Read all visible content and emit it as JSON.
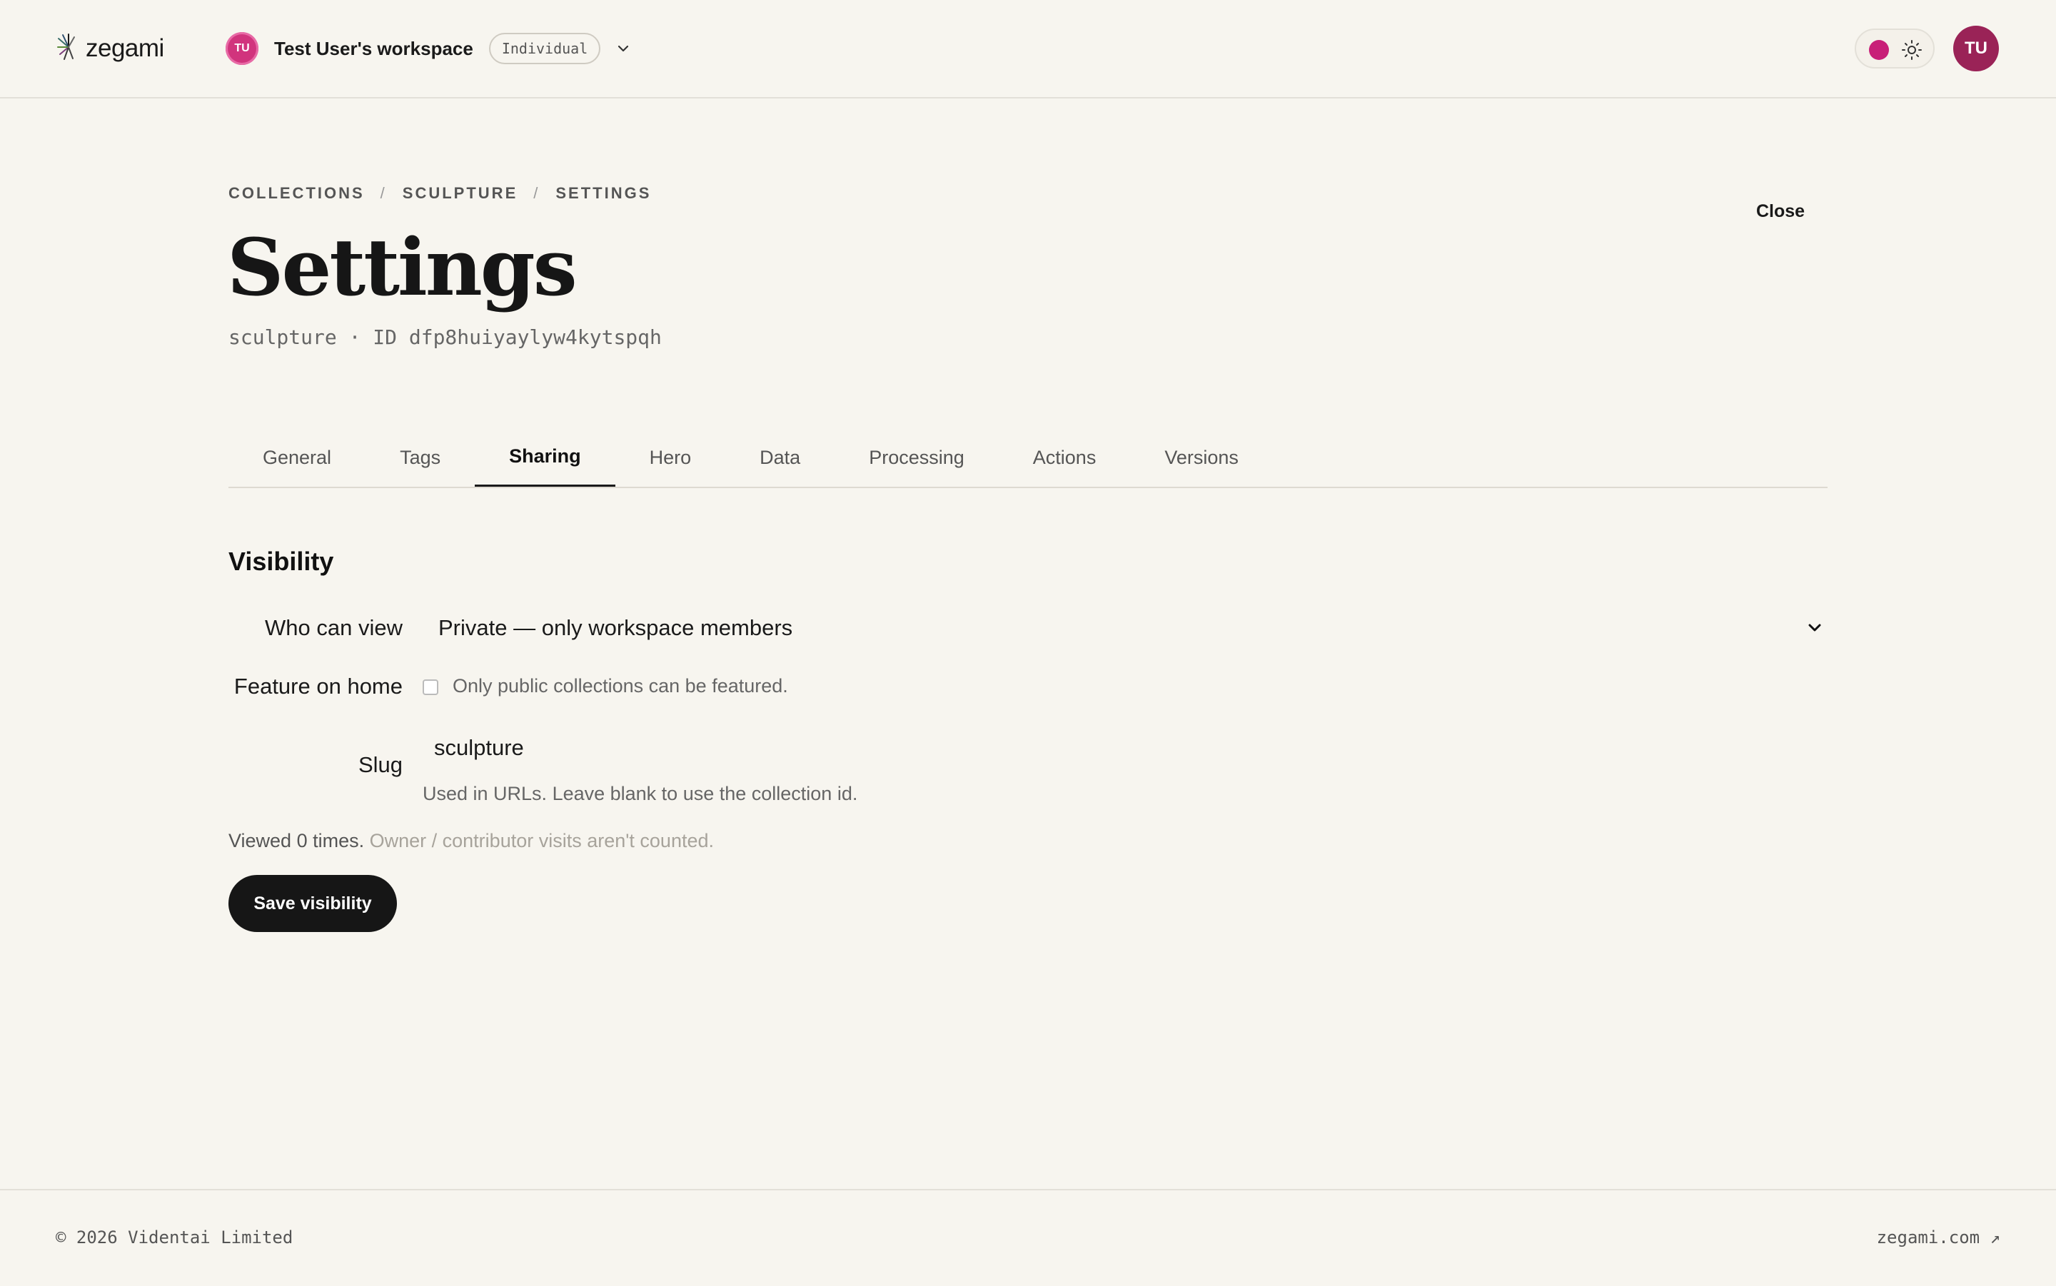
{
  "header": {
    "logo_text": "zegami",
    "workspace": {
      "avatar_initials": "TU",
      "name": "Test User's workspace",
      "plan_badge": "Individual"
    },
    "theme_accent": "#c81f78",
    "user_avatar_initials": "TU"
  },
  "breadcrumb": [
    "COLLECTIONS",
    "SCULPTURE",
    "SETTINGS"
  ],
  "breadcrumb_separator": "/",
  "close_label": "Close",
  "page_title": "Settings",
  "subtitle": "sculpture · ID dfp8huiyaylyw4kytspqh",
  "tabs": [
    {
      "label": "General"
    },
    {
      "label": "Tags"
    },
    {
      "label": "Sharing",
      "active": true
    },
    {
      "label": "Hero"
    },
    {
      "label": "Data"
    },
    {
      "label": "Processing"
    },
    {
      "label": "Actions"
    },
    {
      "label": "Versions"
    }
  ],
  "visibility": {
    "title": "Visibility",
    "who_can_view_label": "Who can view",
    "who_can_view_value": "Private — only workspace members",
    "feature_label": "Feature on home",
    "feature_note": "Only public collections can be featured.",
    "feature_checked": false,
    "slug_label": "Slug",
    "slug_value": "sculpture",
    "slug_help": "Used in URLs. Leave blank to use the collection id.",
    "views_text": "Viewed 0 times.",
    "views_note": "Owner / contributor visits aren't counted.",
    "save_label": "Save visibility"
  },
  "footer": {
    "copyright": "© 2026 Videntai Limited",
    "link": "zegami.com ↗"
  }
}
